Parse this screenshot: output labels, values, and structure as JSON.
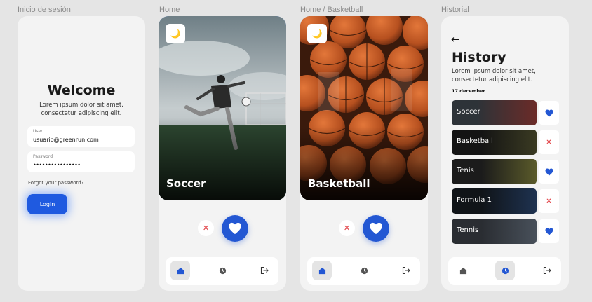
{
  "frames": {
    "login": "Inicio de sesión",
    "home": "Home",
    "home_basketball": "Home / Basketball",
    "history": "Historial"
  },
  "login": {
    "title": "Welcome",
    "subtitle": "Lorem ipsum dolor sit amet, consectetur adipiscing elit.",
    "user_label": "User",
    "user_value": "usuario@greenrun.com",
    "password_label": "Password",
    "password_value": "••••••••••••••••",
    "forgot": "Forgot your password?",
    "login_button": "Login"
  },
  "home": {
    "card_title": "Soccer",
    "theme_icon": "moon-icon"
  },
  "home_basketball": {
    "card_title": "Basketball",
    "theme_icon": "moon-icon"
  },
  "history": {
    "title": "History",
    "subtitle": "Lorem ipsum dolor sit amet, consectetur adipiscing elit.",
    "date": "17 december",
    "items": [
      {
        "name": "Soccer",
        "status": "liked"
      },
      {
        "name": "Basketball",
        "status": "disliked"
      },
      {
        "name": "Tenis",
        "status": "liked"
      },
      {
        "name": "Formula 1",
        "status": "disliked"
      },
      {
        "name": "Tennis",
        "status": "liked"
      }
    ]
  },
  "colors": {
    "accent": "#2357d3",
    "dislike": "#e0393e",
    "background": "#e5e5e5",
    "screen": "#f3f3f3"
  },
  "icons": {
    "dislike": "x-icon",
    "like": "heart-icon",
    "home": "home-icon",
    "history": "clock-icon",
    "logout": "logout-icon",
    "back": "back-arrow-icon"
  }
}
